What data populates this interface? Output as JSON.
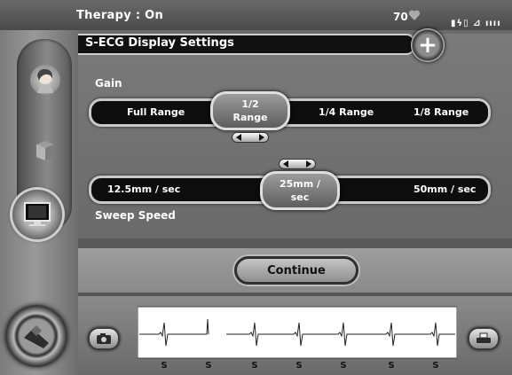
{
  "status_bar": {
    "therapy": "Therapy : On",
    "heart_rate": "70",
    "heart_icon": "heart-icon",
    "status_icons_text": "▮ϟ▯ ⊿ ıııı"
  },
  "rail": {
    "patient_icon": "patient-icon",
    "device_icon": "device-box-icon",
    "display_icon": "display-monitor-icon",
    "bottom_icon": "hand-wand-icon"
  },
  "settings": {
    "title": "S-ECG Display Settings",
    "plus_label": "+"
  },
  "gain": {
    "label": "Gain",
    "options": [
      "Full Range",
      "1/2 Range",
      "1/4 Range",
      "1/8 Range"
    ],
    "selected_line1": "1/2",
    "selected_line2": "Range"
  },
  "sweep": {
    "label": "Sweep Speed",
    "options": [
      "12.5mm / sec",
      "25mm / sec",
      "50mm / sec"
    ],
    "selected_line1": "25mm /",
    "selected_line2": "sec"
  },
  "continue_label": "Continue",
  "ecg": {
    "beat_markers": [
      "S",
      "S",
      "S",
      "S",
      "S",
      "S",
      "S"
    ]
  },
  "colors": {
    "track": "#0d0d0d",
    "selected_fill": "#8a8a8a",
    "text": "#ffffff"
  }
}
